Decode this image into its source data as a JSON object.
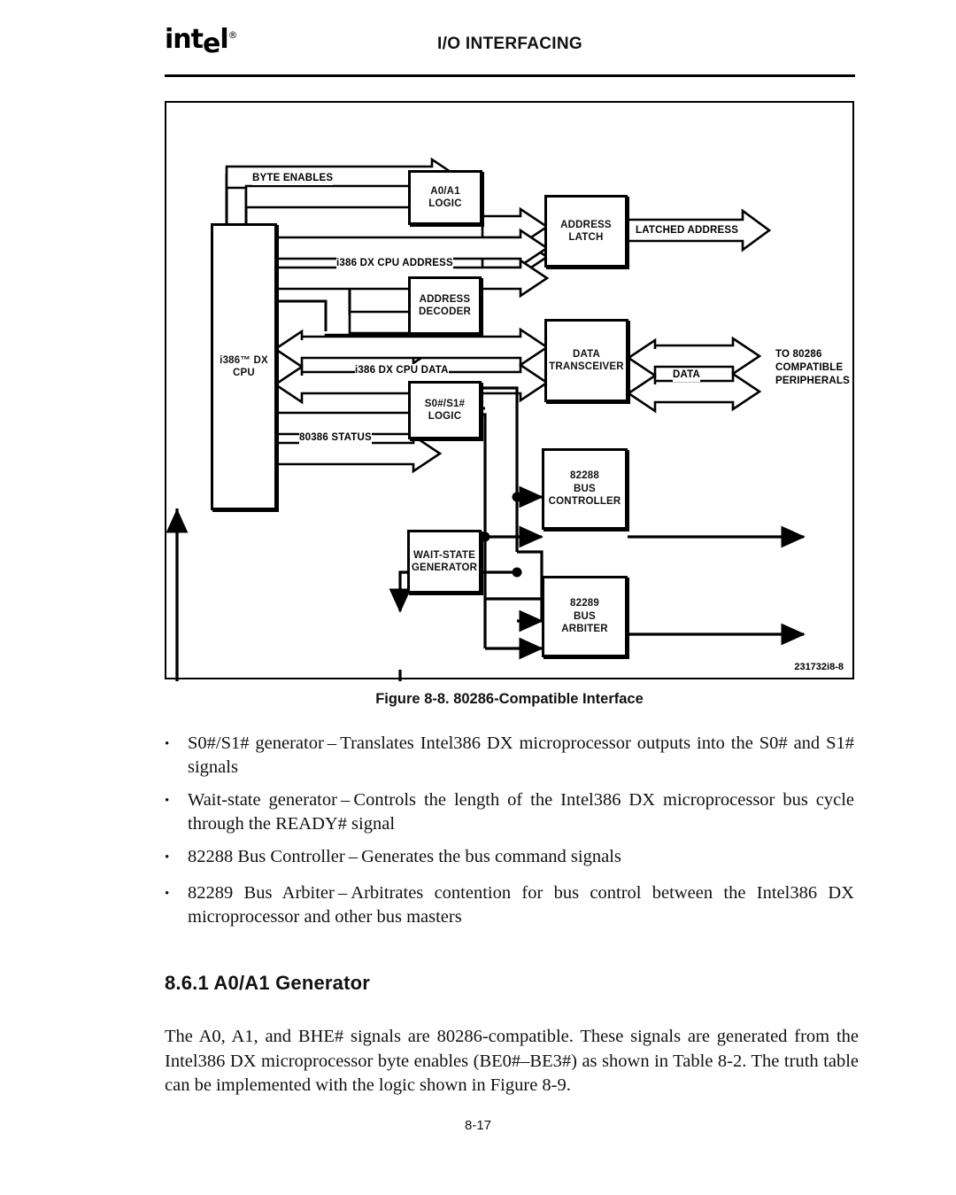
{
  "header": {
    "logo_text": "intel",
    "logo_registered": "®",
    "title": "I/O INTERFACING"
  },
  "figure": {
    "id_code": "231732i8-8",
    "caption": "Figure 8-8. 80286-Compatible Interface",
    "blocks": {
      "cpu": "i386™ DX\nCPU",
      "a0a1_logic": "A0/A1\nLOGIC",
      "address_latch": "ADDRESS\nLATCH",
      "address_decoder": "ADDRESS\nDECODER",
      "data_transceiver": "DATA\nTRANSCEIVER",
      "s0s1_logic": "S0#/S1#\nLOGIC",
      "bus_controller": "82288\nBUS\nCONTROLLER",
      "wait_state_generator": "WAIT-STATE\nGENERATOR",
      "bus_arbiter": "82289\nBUS\nARBITER"
    },
    "signals": {
      "byte_enables": "BYTE ENABLES",
      "cpu_address": "i386 DX CPU ADDRESS",
      "latched_address": "LATCHED ADDRESS",
      "cpu_data": "i386 DX CPU DATA",
      "data": "DATA",
      "status": "80386 STATUS",
      "peripherals": "TO 80286\nCOMPATIBLE\nPERIPHERALS"
    }
  },
  "bullets": [
    {
      "marker": "•",
      "text": "S0#/S1# generator – Translates Intel386 DX microprocessor outputs into the S0# and S1# signals"
    },
    {
      "marker": "•",
      "text": "Wait-state generator – Controls the length of the Intel386 DX microprocessor bus cycle through the READY# signal"
    },
    {
      "marker": "•",
      "text": "82288 Bus Controller – Generates the bus command signals"
    },
    {
      "marker": "•",
      "text": "82289 Bus Arbiter – Arbitrates contention for bus control between the Intel386 DX microprocessor and other bus masters"
    }
  ],
  "section": {
    "heading": "8.6.1  A0/A1 Generator",
    "paragraph": "The A0, A1, and BHE# signals are 80286-compatible. These signals are generated from the Intel386 DX microprocessor byte enables (BE0#–BE3#) as shown in Table 8-2. The truth table can be implemented with the logic shown in Figure 8-9."
  },
  "footer": {
    "page_number": "8-17"
  }
}
